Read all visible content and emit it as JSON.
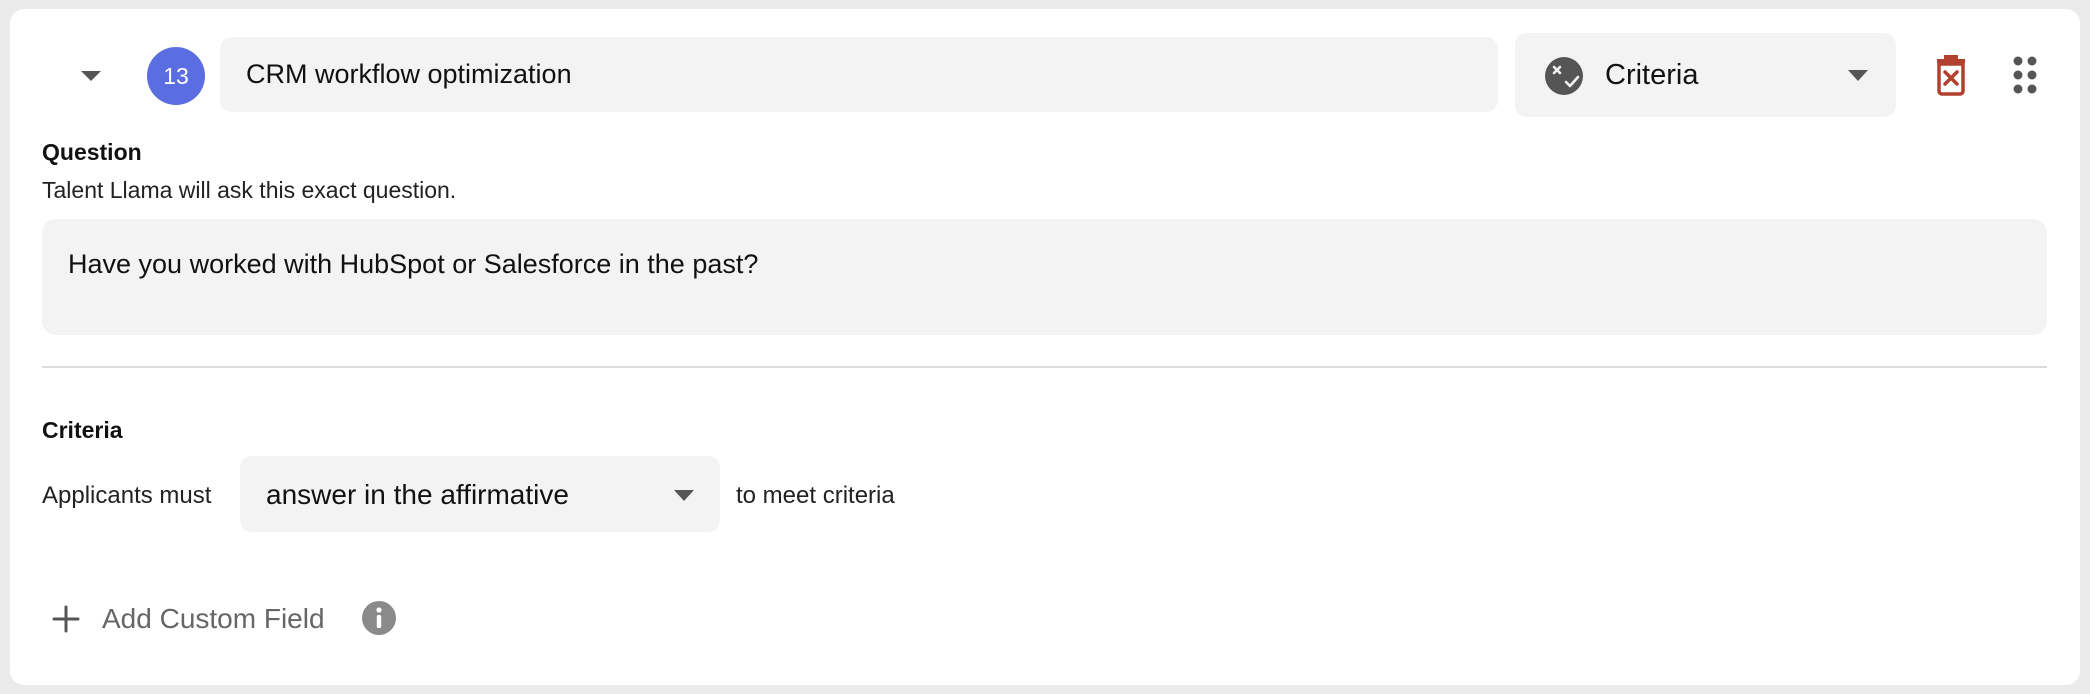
{
  "question_card": {
    "number": "13",
    "title_value": "CRM workflow optimization",
    "type_select": {
      "label": "Criteria",
      "icon": "criteria-face-icon"
    },
    "actions": {
      "delete_icon": "trash-icon",
      "drag_icon": "drag-handle-icon"
    }
  },
  "question": {
    "heading": "Question",
    "helper": "Talent Llama will ask this exact question.",
    "value": "Have you worked with HubSpot or Salesforce in the past?"
  },
  "criteria": {
    "heading": "Criteria",
    "prefix": "Applicants must",
    "selected": "answer in the affirmative",
    "suffix": "to meet criteria"
  },
  "add_custom_field": {
    "label": "Add Custom Field"
  },
  "colors": {
    "badge": "#5b6ee1",
    "delete": "#b2402f",
    "field_bg": "#f3f3f3",
    "page_bg": "#ebebeb"
  }
}
